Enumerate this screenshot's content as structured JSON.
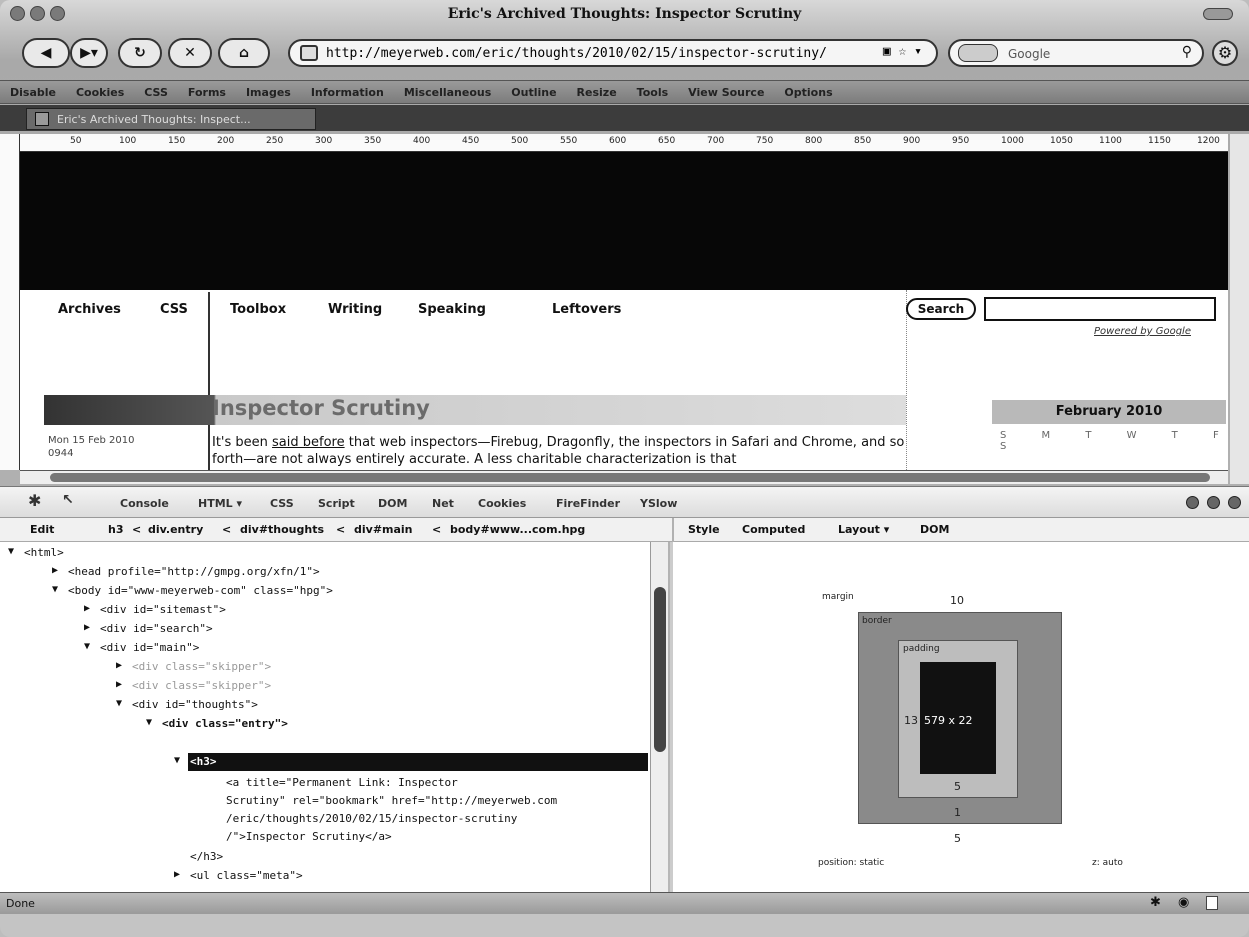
{
  "window": {
    "title": "Eric's Archived Thoughts: Inspector Scrutiny"
  },
  "toolbar": {
    "back_icon": "back-arrow-icon",
    "forward_icon": "forward-arrow-icon",
    "url": "http://meyerweb.com/eric/thoughts/2010/02/15/inspector-scrutiny/",
    "search_placeholder": "Google"
  },
  "webdev_bar": {
    "items": [
      "Disable",
      "Cookies",
      "CSS",
      "Forms",
      "Images",
      "Information",
      "Miscellaneous",
      "Outline",
      "Resize",
      "Tools",
      "View Source",
      "Options"
    ]
  },
  "tab": {
    "label": "Eric's Archived Thoughts: Inspect..."
  },
  "ruler": {
    "ticks": [
      "50",
      "100",
      "150",
      "200",
      "250",
      "300",
      "350",
      "400",
      "450",
      "500",
      "550",
      "600",
      "650",
      "700",
      "750",
      "800",
      "850",
      "900",
      "950",
      "1000",
      "1050",
      "1100",
      "1150",
      "1200"
    ]
  },
  "page": {
    "nav": [
      "Archives",
      "CSS",
      "Toolbox",
      "Writing",
      "Speaking",
      "Leftovers"
    ],
    "search_button": "Search",
    "powered": "Powered by Google",
    "heading": "Inspector Scrutiny",
    "month": "February 2010",
    "cal_days": "S M T W T F S",
    "date_line1": "Mon 15 Feb 2010",
    "date_line2": "0944",
    "para_before": "It's been ",
    "para_link": "said before",
    "para_after": " that web inspectors—Firebug, Dragonfly, the inspectors in Safari and Chrome, and so forth—are not always entirely accurate. A less charitable characterization is that"
  },
  "firebug": {
    "tabs": [
      "Console",
      "HTML ▾",
      "CSS",
      "Script",
      "DOM",
      "Net",
      "Cookies",
      "FireFinder",
      "YSlow"
    ],
    "edit": "Edit",
    "breadcrumb": [
      "h3",
      "<",
      "div.entry",
      "<",
      "div#thoughts",
      "<",
      "div#main",
      "<",
      "body#www...com.hpg"
    ],
    "right_tabs": [
      "Style",
      "Computed",
      "Layout ▾",
      "DOM"
    ],
    "tree": [
      "<html>",
      "<head profile=\"http://gmpg.org/xfn/1\">",
      "<body id=\"www-meyerweb-com\" class=\"hpg\">",
      "<div id=\"sitemast\">",
      "<div id=\"search\">",
      "<div id=\"main\">",
      "<div class=\"skipper\">",
      "<div class=\"skipper\">",
      "<div id=\"thoughts\">",
      "<div class=\"entry\">",
      "<h3>",
      "<a title=\"Permanent Link: Inspector",
      "Scrutiny\" rel=\"bookmark\" href=\"http://meyerweb.com",
      "/eric/thoughts/2010/02/15/inspector-scrutiny",
      "/\">Inspector Scrutiny</a>",
      "</h3>",
      "<ul class=\"meta\">"
    ],
    "layout": {
      "margin_label": "margin",
      "margin_top": "10",
      "border_label": "border",
      "padding_label": "padding",
      "left_value": "13",
      "content_size": "579 x 22",
      "padding_bottom": "5",
      "border_bottom": "1",
      "margin_bottom": "5",
      "position": "position: static",
      "zindex": "z: auto"
    }
  },
  "status": {
    "text": "Done"
  }
}
